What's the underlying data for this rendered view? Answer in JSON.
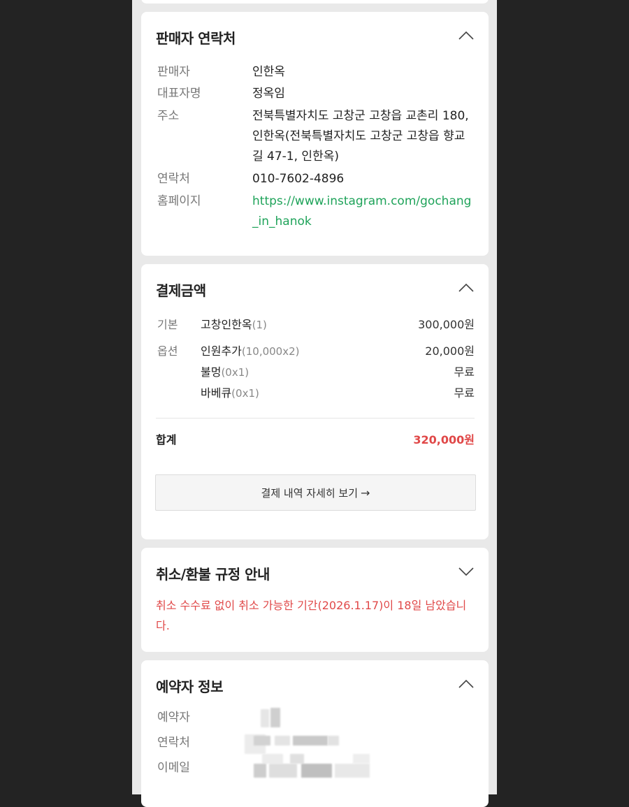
{
  "seller_contact": {
    "title": "판매자 연락처",
    "rows": [
      {
        "label": "판매자",
        "value": "인한옥"
      },
      {
        "label": "대표자명",
        "value": "정옥임"
      },
      {
        "label": "주소",
        "value": "전북특별자치도 고창군 고창읍 교촌리 180, 인한옥(전북특별자치도 고창군 고창읍 향교길 47-1, 인한옥)"
      },
      {
        "label": "연락처",
        "value": "010-7602-4896"
      },
      {
        "label": "홈페이지",
        "value": "https://www.instagram.com/gochang_in_hanok"
      }
    ]
  },
  "payment": {
    "title": "결제금액",
    "basic_label": "기본",
    "basic_item": {
      "name": "고창인한옥",
      "qty": "(1)",
      "amount": "300,000원"
    },
    "option_label": "옵션",
    "options": [
      {
        "name": "인원추가",
        "qty": "(10,000x2)",
        "amount": "20,000원"
      },
      {
        "name": "불멍",
        "qty": "(0x1)",
        "amount": "무료"
      },
      {
        "name": "바베큐",
        "qty": "(0x1)",
        "amount": "무료"
      }
    ],
    "total_label": "합계",
    "total_value": "320,000원",
    "detail_button": "결제 내역 자세히 보기",
    "detail_arrow": "→"
  },
  "refund": {
    "title": "취소/환불 규정 안내",
    "notice": "취소 수수료 없이 취소 가능한 기간(2026.1.17)이 18일 남았습니다."
  },
  "booker": {
    "title": "예약자 정보",
    "rows": [
      {
        "label": "예약자"
      },
      {
        "label": "연락처"
      },
      {
        "label": "이메일"
      }
    ]
  },
  "icons": {
    "expanded": "chevron-up-icon",
    "collapsed": "chevron-down-icon"
  },
  "colors": {
    "link": "#1fa35a",
    "total": "#e04848",
    "notice": "#e04848"
  }
}
